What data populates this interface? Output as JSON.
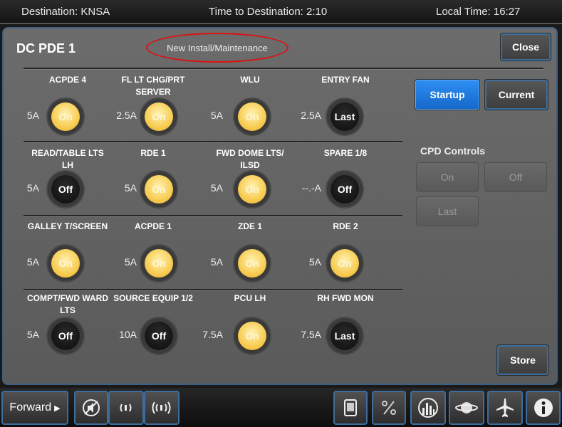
{
  "header": {
    "destination": "Destination: KNSA",
    "time_to_destination": "Time to Destination: 2:10",
    "local_time": "Local Time: 16:27"
  },
  "panel": {
    "title": "DC PDE 1",
    "subtitle": "New Install/Maintenance",
    "close_label": "Close",
    "startup_label": "Startup",
    "current_label": "Current",
    "store_label": "Store"
  },
  "cpd": {
    "title": "CPD Controls",
    "on_label": "On",
    "off_label": "Off",
    "last_label": "Last"
  },
  "rows": [
    [
      {
        "label": "ACPDE 4",
        "amp": "5A",
        "state": "On",
        "kind": "on"
      },
      {
        "label": "FL LT CHG/PRT SERVER",
        "amp": "2.5A",
        "state": "On",
        "kind": "on"
      },
      {
        "label": "WLU",
        "amp": "5A",
        "state": "On",
        "kind": "on"
      },
      {
        "label": "ENTRY FAN",
        "amp": "2.5A",
        "state": "Last",
        "kind": "off"
      }
    ],
    [
      {
        "label": "READ/TABLE LTS LH",
        "amp": "5A",
        "state": "Off",
        "kind": "off"
      },
      {
        "label": "RDE 1",
        "amp": "5A",
        "state": "On",
        "kind": "on"
      },
      {
        "label": "FWD DOME LTS/ ILSD",
        "amp": "5A",
        "state": "On",
        "kind": "on"
      },
      {
        "label": "SPARE 1/8",
        "amp": "--.-A",
        "state": "Off",
        "kind": "off"
      }
    ],
    [
      {
        "label": "GALLEY T/SCREEN",
        "amp": "5A",
        "state": "On",
        "kind": "on"
      },
      {
        "label": "ACPDE 1",
        "amp": "5A",
        "state": "On",
        "kind": "on"
      },
      {
        "label": "ZDE 1",
        "amp": "5A",
        "state": "On",
        "kind": "on"
      },
      {
        "label": "RDE 2",
        "amp": "5A",
        "state": "On",
        "kind": "on"
      }
    ],
    [
      {
        "label": "COMPT/FWD WARD LTS",
        "amp": "5A",
        "state": "Off",
        "kind": "off"
      },
      {
        "label": "SOURCE EQUIP 1/2",
        "amp": "10A",
        "state": "Off",
        "kind": "off"
      },
      {
        "label": "PCU LH",
        "amp": "7.5A",
        "state": "On",
        "kind": "on"
      },
      {
        "label": "RH FWD MON",
        "amp": "7.5A",
        "state": "Last",
        "kind": "off"
      }
    ]
  ],
  "bottom_nav": {
    "forward_label": "Forward",
    "icons": [
      "mute-icon",
      "volume-low-icon",
      "volume-high-icon",
      "screen-icon",
      "percent-icon",
      "building-icon",
      "planet-icon",
      "airplane-icon",
      "info-icon"
    ]
  }
}
